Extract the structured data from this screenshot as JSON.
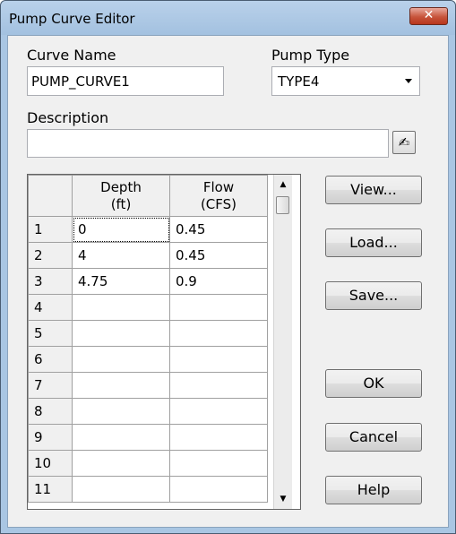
{
  "window": {
    "title": "Pump Curve Editor",
    "close_glyph": "✕"
  },
  "fields": {
    "curve_name_label": "Curve Name",
    "curve_name_value": "PUMP_CURVE1",
    "pump_type_label": "Pump Type",
    "pump_type_value": "TYPE4",
    "description_label": "Description",
    "description_value": ""
  },
  "grid": {
    "headers": [
      {
        "line1": "",
        "line2": ""
      },
      {
        "line1": "Depth",
        "line2": "(ft)"
      },
      {
        "line1": "Flow",
        "line2": "(CFS)"
      }
    ],
    "rows": [
      {
        "num": "1",
        "depth": "0",
        "flow": "0.45"
      },
      {
        "num": "2",
        "depth": "4",
        "flow": "0.45"
      },
      {
        "num": "3",
        "depth": "4.75",
        "flow": "0.9"
      },
      {
        "num": "4",
        "depth": "",
        "flow": ""
      },
      {
        "num": "5",
        "depth": "",
        "flow": ""
      },
      {
        "num": "6",
        "depth": "",
        "flow": ""
      },
      {
        "num": "7",
        "depth": "",
        "flow": ""
      },
      {
        "num": "8",
        "depth": "",
        "flow": ""
      },
      {
        "num": "9",
        "depth": "",
        "flow": ""
      },
      {
        "num": "10",
        "depth": "",
        "flow": ""
      },
      {
        "num": "11",
        "depth": "",
        "flow": ""
      }
    ],
    "scroll_up_glyph": "▲",
    "scroll_down_glyph": "▼"
  },
  "buttons": {
    "view": "View...",
    "load": "Load...",
    "save": "Save...",
    "ok": "OK",
    "cancel": "Cancel",
    "help": "Help"
  },
  "icons": {
    "edit_description": "edit-pencil-icon",
    "edit_glyph": "✍"
  }
}
